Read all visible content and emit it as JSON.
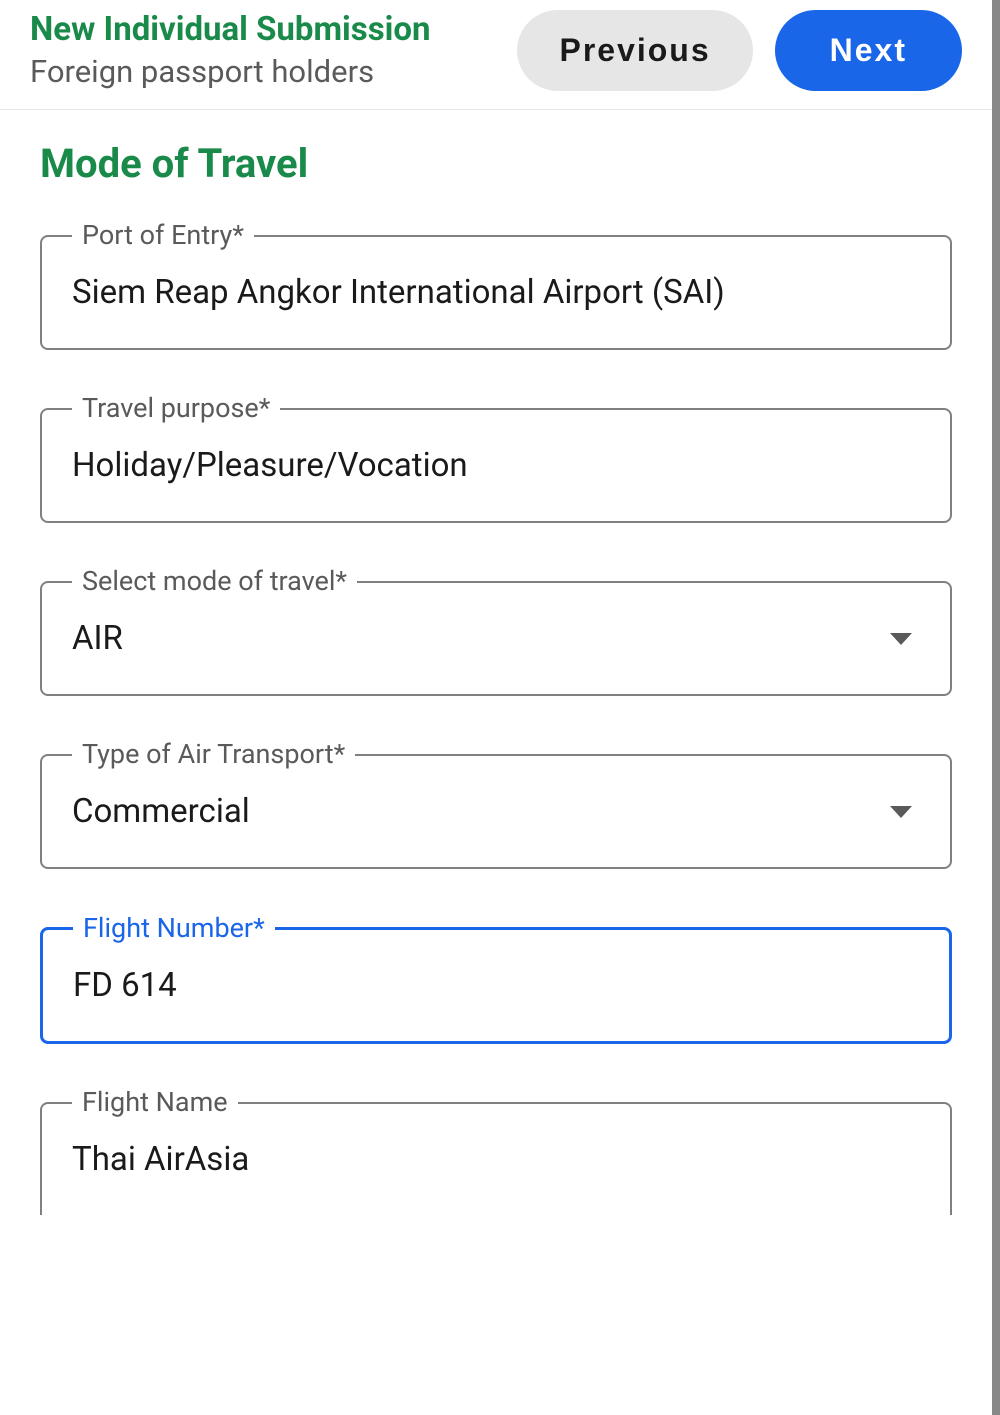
{
  "header": {
    "title": "New Individual Submission",
    "subtitle": "Foreign passport holders",
    "previous_label": "Previous",
    "next_label": "Next"
  },
  "section": {
    "title": "Mode of Travel"
  },
  "fields": {
    "port_of_entry": {
      "label": "Port of Entry*",
      "value": "Siem Reap Angkor International Airport (SAI)"
    },
    "travel_purpose": {
      "label": "Travel purpose*",
      "value": "Holiday/Pleasure/Vocation"
    },
    "mode_of_travel": {
      "label": "Select mode of travel*",
      "value": "AIR"
    },
    "air_transport_type": {
      "label": "Type of Air Transport*",
      "value": "Commercial"
    },
    "flight_number": {
      "label": "Flight Number*",
      "value": "FD 614"
    },
    "flight_name": {
      "label": "Flight Name",
      "value": "Thai AirAsia"
    }
  }
}
